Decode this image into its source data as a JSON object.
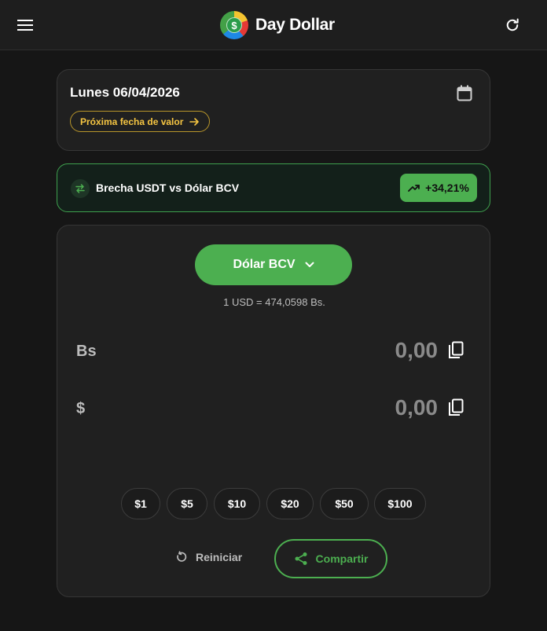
{
  "app": {
    "name": "Day Dollar",
    "logo_symbol": "$"
  },
  "date_card": {
    "date": "Lunes 06/04/2026",
    "next_date_label": "Próxima fecha de valor"
  },
  "gap": {
    "label": "Brecha USDT vs Dólar BCV",
    "value": "+34,21%"
  },
  "converter": {
    "rate_selector": "Dólar BCV",
    "rate_line": "1 USD = 474,0598 Bs.",
    "bs": {
      "currency": "Bs",
      "value": "0,00"
    },
    "usd": {
      "currency": "$",
      "value": "0,00"
    },
    "quick_amounts": [
      "$1",
      "$5",
      "$10",
      "$20",
      "$50",
      "$100"
    ],
    "reset_label": "Reiniciar",
    "share_label": "Compartir"
  },
  "colors": {
    "accent": "#4caf50",
    "warning": "#f5c542",
    "background": "#161616",
    "card": "#202020"
  }
}
